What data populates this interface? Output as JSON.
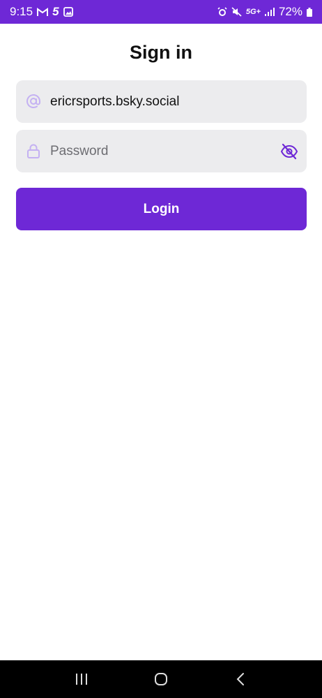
{
  "status_bar": {
    "time": "9:15",
    "carrier_badge": "5",
    "network": "5G+",
    "battery": "72%",
    "icons": [
      "gmail-icon",
      "carrier-5-icon",
      "gallery-icon",
      "alarm-icon",
      "mute-icon",
      "network-5g-icon",
      "signal-icon",
      "battery-icon"
    ]
  },
  "page": {
    "title": "Sign in"
  },
  "form": {
    "username": {
      "value": "ericrsports.bsky.social",
      "icon": "at-icon"
    },
    "password": {
      "value": "",
      "placeholder": "Password",
      "icon": "lock-icon",
      "toggle_icon": "eye-off-icon"
    },
    "login_label": "Login"
  },
  "nav_bar": {
    "buttons": [
      "recents-icon",
      "home-icon",
      "back-icon"
    ]
  },
  "colors": {
    "accent": "#6e28d6",
    "field_bg": "#ececee",
    "icon_faded": "#c4b1f2"
  }
}
